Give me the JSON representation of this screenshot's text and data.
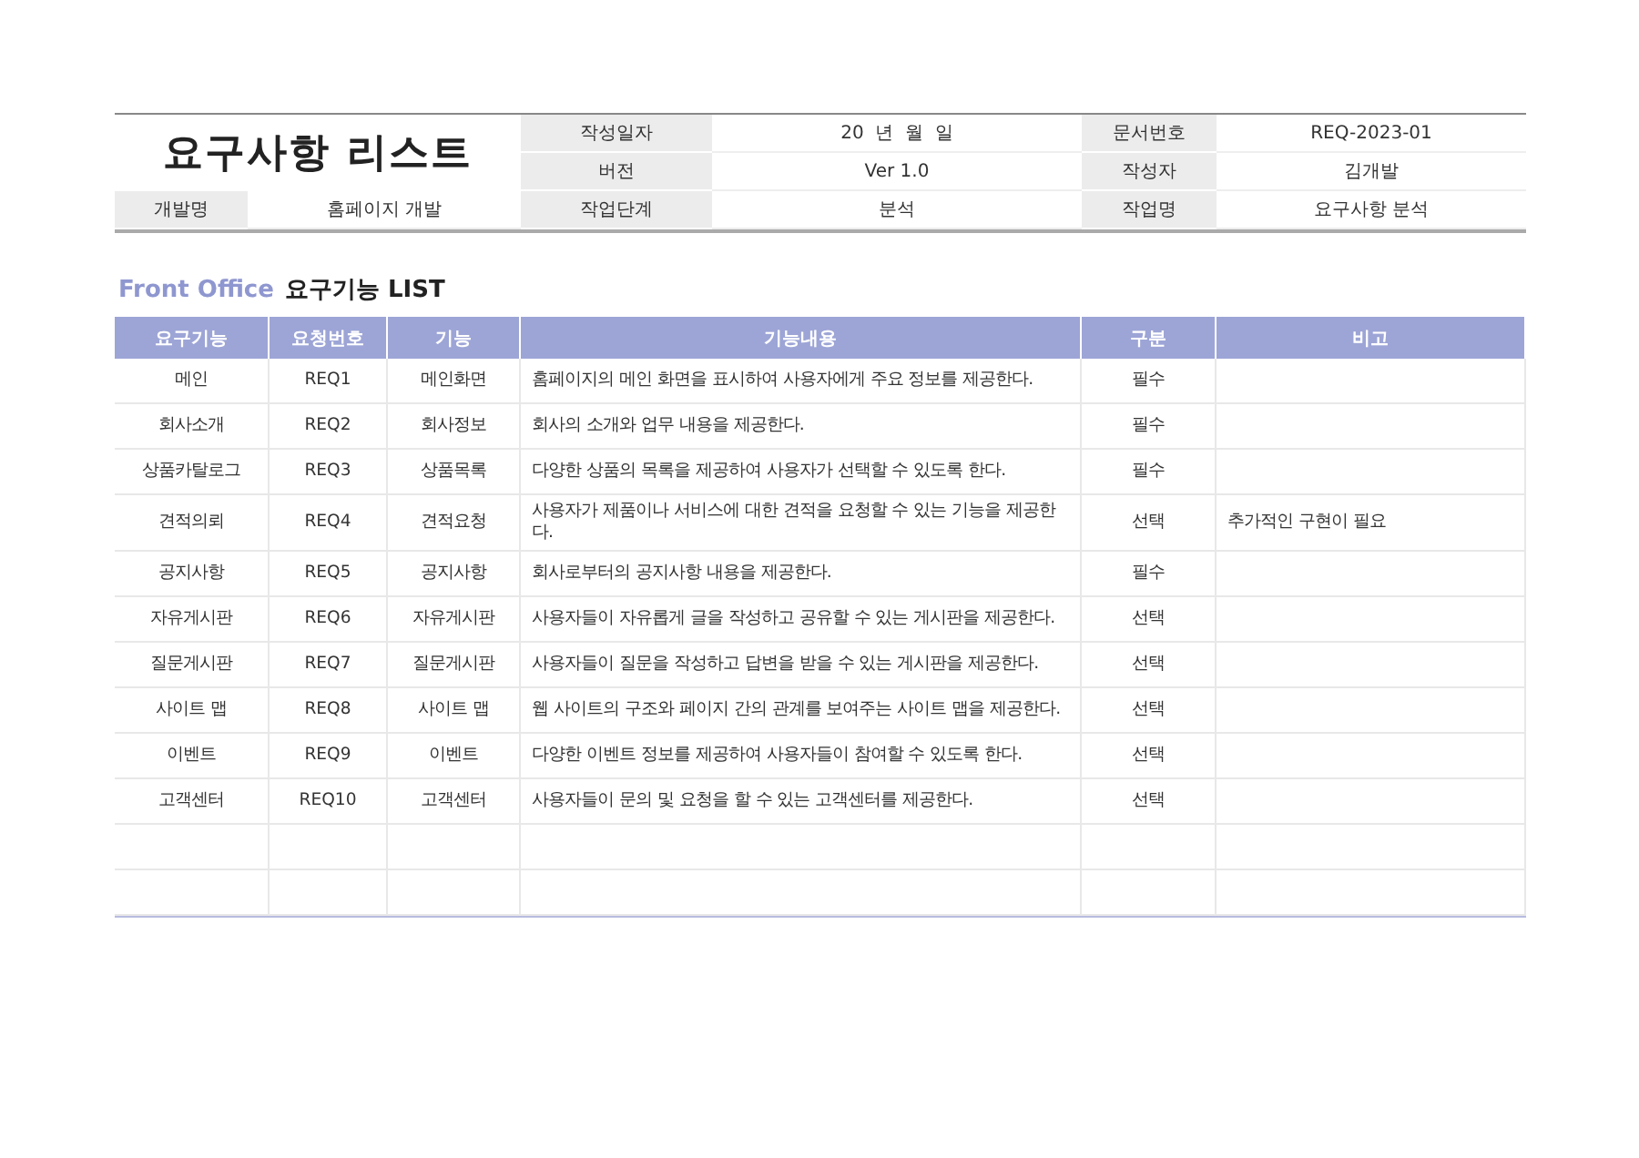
{
  "document_title": "요구사항 리스트",
  "info": [
    {
      "label": "작성일자",
      "value": "20  년  월  일"
    },
    {
      "label": "문서번호",
      "value": "REQ-2023-01"
    },
    {
      "label": "버전",
      "value": "Ver 1.0"
    },
    {
      "label": "작성자",
      "value": "김개발"
    },
    {
      "label": "개발명",
      "value": "홈페이지 개발"
    },
    {
      "label": "작업단계",
      "value": "분석"
    },
    {
      "label": "작업명",
      "value": "요구사항 분석"
    }
  ],
  "section": {
    "prefix": "Front Office",
    "title": "요구기능 LIST"
  },
  "table": {
    "columns": [
      "요구기능",
      "요청번호",
      "기능",
      "기능내용",
      "구분",
      "비고"
    ],
    "rows": [
      [
        "메인",
        "REQ1",
        "메인화면",
        "홈페이지의 메인 화면을 표시하여 사용자에게 주요 정보를 제공한다.",
        "필수",
        ""
      ],
      [
        "회사소개",
        "REQ2",
        "회사정보",
        "회사의 소개와 업무 내용을 제공한다.",
        "필수",
        ""
      ],
      [
        "상품카탈로그",
        "REQ3",
        "상품목록",
        "다양한 상품의 목록을 제공하여 사용자가 선택할 수 있도록 한다.",
        "필수",
        ""
      ],
      [
        "견적의뢰",
        "REQ4",
        "견적요청",
        "사용자가 제품이나 서비스에 대한 견적을 요청할 수 있는 기능을 제공한다.",
        "선택",
        "추가적인 구현이 필요"
      ],
      [
        "공지사항",
        "REQ5",
        "공지사항",
        "회사로부터의 공지사항 내용을 제공한다.",
        "필수",
        ""
      ],
      [
        "자유게시판",
        "REQ6",
        "자유게시판",
        "사용자들이 자유롭게 글을 작성하고 공유할 수 있는 게시판을 제공한다.",
        "선택",
        ""
      ],
      [
        "질문게시판",
        "REQ7",
        "질문게시판",
        "사용자들이 질문을 작성하고 답변을 받을 수 있는 게시판을 제공한다.",
        "선택",
        ""
      ],
      [
        "사이트 맵",
        "REQ8",
        "사이트 맵",
        "웹 사이트의 구조와 페이지 간의 관계를 보여주는 사이트 맵을 제공한다.",
        "선택",
        ""
      ],
      [
        "이벤트",
        "REQ9",
        "이벤트",
        "다양한 이벤트 정보를 제공하여 사용자들이 참여할 수 있도록 한다.",
        "선택",
        ""
      ],
      [
        "고객센터",
        "REQ10",
        "고객센터",
        "사용자들이 문의 및 요청을 할 수 있는 고객센터를 제공한다.",
        "선택",
        ""
      ]
    ]
  }
}
